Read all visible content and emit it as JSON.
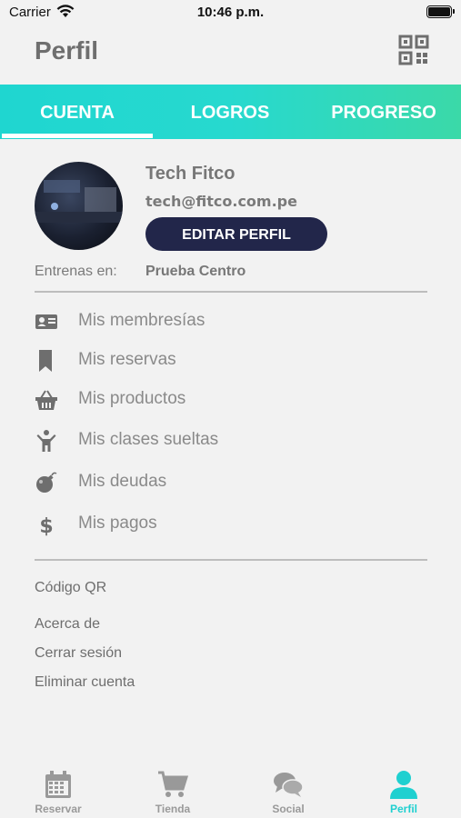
{
  "status_bar": {
    "carrier": "Carrier",
    "time": "10:46 p.m."
  },
  "header": {
    "title": "Perfil",
    "qr_icon": "qr-code-icon"
  },
  "tabs": [
    {
      "label": "CUENTA",
      "active": true
    },
    {
      "label": "LOGROS",
      "active": false
    },
    {
      "label": "PROGRESO",
      "active": false
    }
  ],
  "profile": {
    "name": "Tech Fitco",
    "email": "tech@fitco.com.pe",
    "edit_button": "EDITAR PERFIL",
    "train_label": "Entrenas en:",
    "train_value": "Prueba Centro"
  },
  "menu": [
    {
      "label": "Mis membresías",
      "icon": "id-card-icon"
    },
    {
      "label": "Mis reservas",
      "icon": "bookmark-icon"
    },
    {
      "label": "Mis productos",
      "icon": "basket-icon"
    },
    {
      "label": "Mis clases sueltas",
      "icon": "person-icon"
    },
    {
      "label": "Mis deudas",
      "icon": "bomb-icon"
    },
    {
      "label": "Mis pagos",
      "icon": "dollar-icon"
    }
  ],
  "links": {
    "qr": "Código QR",
    "about": "Acerca de",
    "logout": "Cerrar sesión",
    "delete": "Eliminar cuenta"
  },
  "bottom_nav": [
    {
      "label": "Reservar",
      "icon": "calendar-icon",
      "active": false
    },
    {
      "label": "Tienda",
      "icon": "cart-icon",
      "active": false
    },
    {
      "label": "Social",
      "icon": "chat-icon",
      "active": false
    },
    {
      "label": "Perfil",
      "icon": "user-icon",
      "active": true
    }
  ],
  "colors": {
    "accent": "#1fd0d0",
    "button_dark": "#22264a",
    "text_gray": "#8a8a8a"
  }
}
